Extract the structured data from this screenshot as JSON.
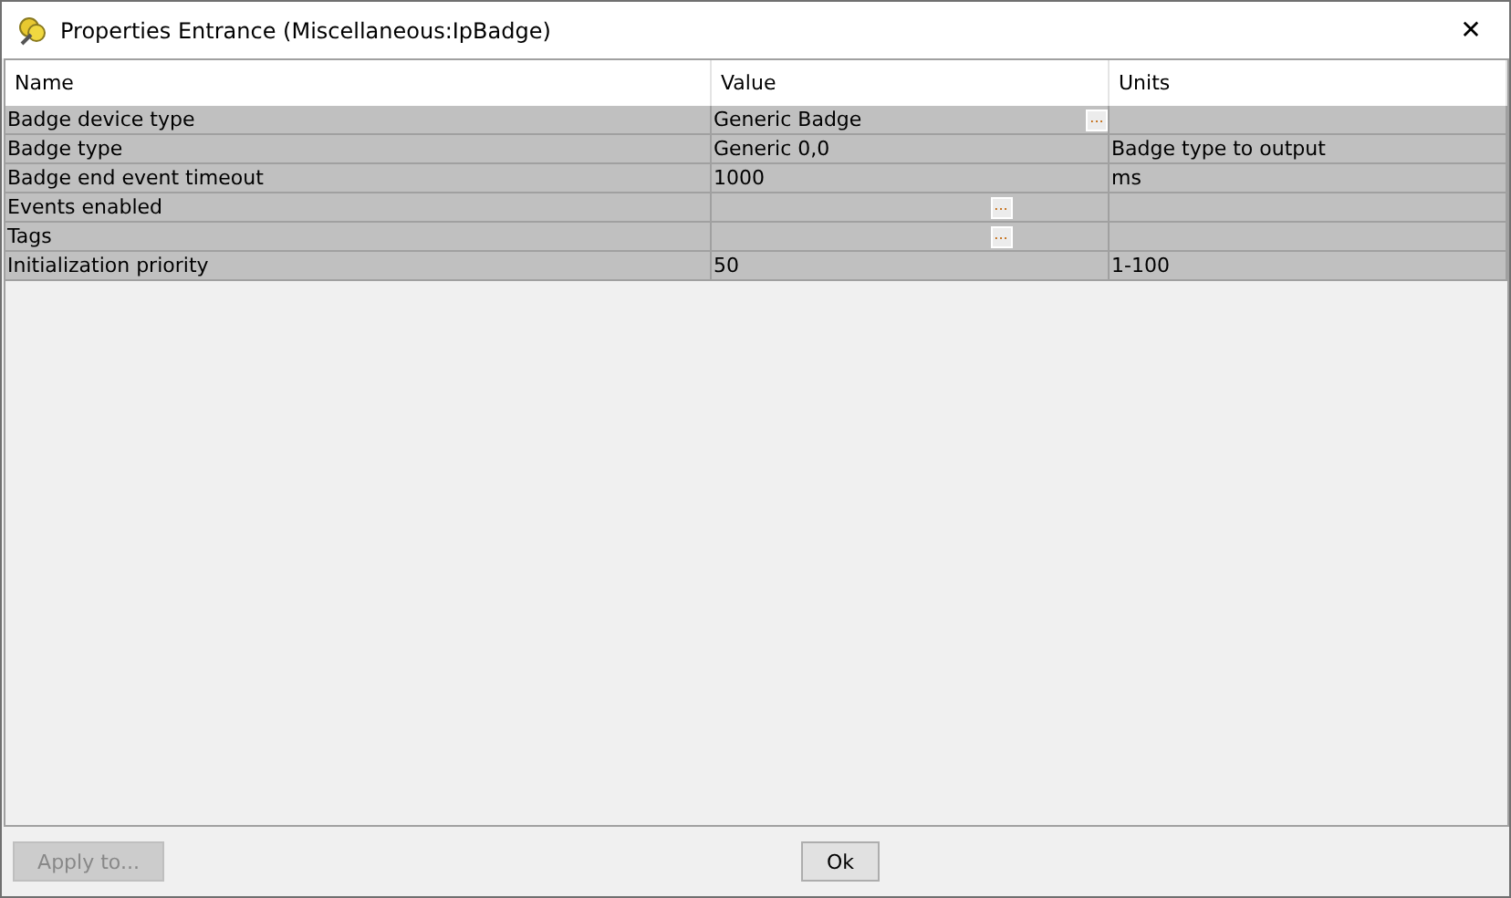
{
  "window": {
    "title": "Properties Entrance (Miscellaneous:IpBadge)",
    "close": "✕"
  },
  "table": {
    "columns": [
      "Name",
      "Value",
      "Units"
    ],
    "rows": [
      {
        "name": "Badge device type",
        "value": "Generic Badge",
        "kind": "list",
        "button": "..."
      },
      {
        "name": "Badge type",
        "value": "Generic 0,0",
        "units": "Badge type to output",
        "kind": "text"
      },
      {
        "name": "Badge end event timeout",
        "value": "1000",
        "units": "ms",
        "kind": "text"
      },
      {
        "name": "Events enabled",
        "kind": "collection",
        "button": "..."
      },
      {
        "name": "Tags",
        "kind": "collection",
        "button": "..."
      },
      {
        "name": "Initialization priority",
        "value": "50",
        "units": "1-100",
        "kind": "text"
      }
    ]
  },
  "buttons": [
    {
      "label": "Apply to...",
      "disabled": true
    },
    {
      "label": "Ok",
      "disabled": false
    }
  ]
}
